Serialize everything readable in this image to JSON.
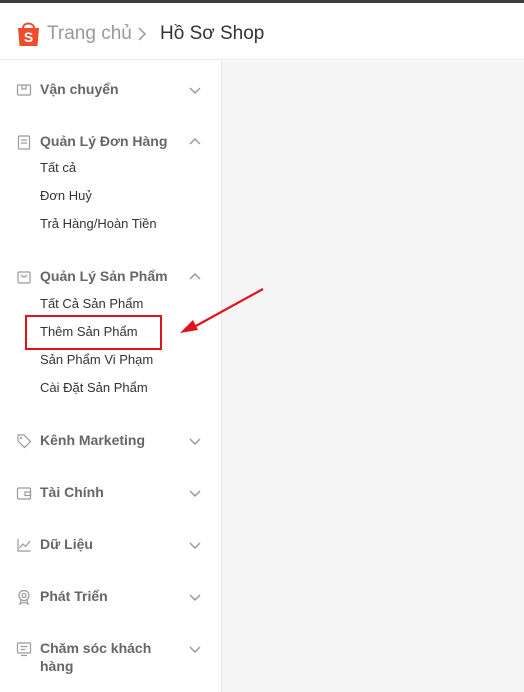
{
  "header": {
    "home_label": "Trang chủ",
    "current_label": "Hồ Sơ Shop",
    "brand_color": "#ee4d2d"
  },
  "sidebar": {
    "sections": [
      {
        "label": "Vận chuyển",
        "icon": "truck-icon",
        "expanded": false
      },
      {
        "label": "Quản Lý Đơn Hàng",
        "icon": "clipboard-icon",
        "expanded": true,
        "items": [
          "Tất cả",
          "Đơn Huỷ",
          "Trả Hàng/Hoàn Tiền"
        ]
      },
      {
        "label": "Quản Lý Sản Phẩm",
        "icon": "bag-icon",
        "expanded": true,
        "items": [
          "Tất Cả Sản Phẩm",
          "Thêm Sản Phẩm",
          "Sản Phẩm Vi Phạm",
          "Cài Đặt Sản Phẩm"
        ]
      },
      {
        "label": "Kênh Marketing",
        "icon": "tag-icon",
        "expanded": false
      },
      {
        "label": "Tài Chính",
        "icon": "wallet-icon",
        "expanded": false
      },
      {
        "label": "Dữ Liệu",
        "icon": "chart-icon",
        "expanded": false
      },
      {
        "label": "Phát Triển",
        "icon": "badge-icon",
        "expanded": false
      },
      {
        "label": "Chăm sóc khách hàng",
        "icon": "chat-icon",
        "expanded": false
      }
    ]
  },
  "annotation": {
    "highlight_color": "#e0131d"
  }
}
